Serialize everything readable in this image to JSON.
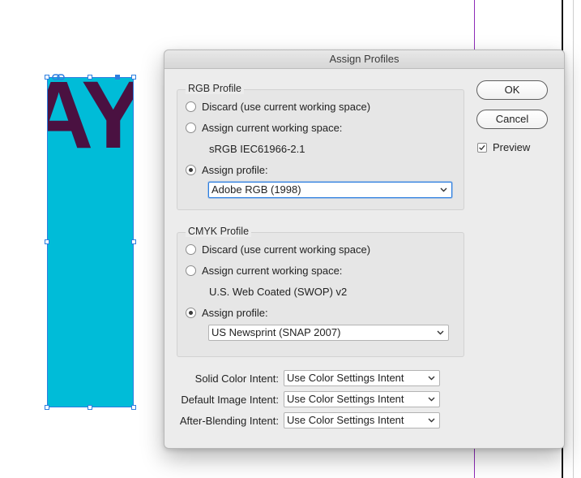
{
  "dialog": {
    "title": "Assign Profiles",
    "ok_label": "OK",
    "cancel_label": "Cancel",
    "preview_label": "Preview",
    "preview_checked": true
  },
  "rgb": {
    "legend": "RGB Profile",
    "discard_label": "Discard (use current working space)",
    "assign_current_label": "Assign current working space:",
    "current_space": "sRGB IEC61966-2.1",
    "assign_profile_label": "Assign profile:",
    "profile_value": "Adobe RGB (1998)",
    "selected": "assign_profile"
  },
  "cmyk": {
    "legend": "CMYK Profile",
    "discard_label": "Discard (use current working space)",
    "assign_current_label": "Assign current working space:",
    "current_space": "U.S. Web Coated (SWOP) v2",
    "assign_profile_label": "Assign profile:",
    "profile_value": "US Newsprint (SNAP 2007)",
    "selected": "assign_profile"
  },
  "intents": {
    "solid_label": "Solid Color Intent:",
    "solid_value": "Use Color Settings Intent",
    "image_label": "Default Image Intent:",
    "image_value": "Use Color Settings Intent",
    "blending_label": "After-Blending Intent:",
    "blending_value": "Use Color Settings Intent"
  },
  "canvas": {
    "frame_text": "AY",
    "frame_color": "#00bcd8",
    "text_color": "#4a1141"
  },
  "colors": {
    "selection": "#2d7ee0",
    "guide": "#8e2bb8"
  }
}
